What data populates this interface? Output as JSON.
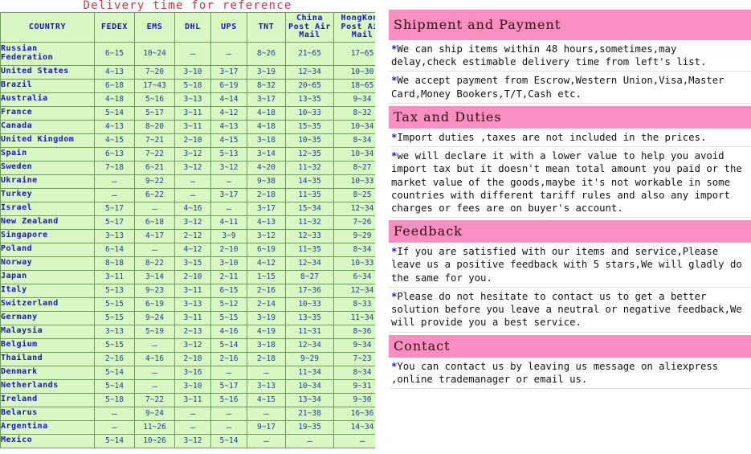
{
  "table": {
    "title": "Delivery time for reference",
    "columns": [
      "COUNTRY",
      "FEDEX",
      "EMS",
      "DHL",
      "UPS",
      "TNT",
      "China Post Air Mail",
      "HongKong Post Air Mail"
    ],
    "column_lines": [
      [
        "COUNTRY"
      ],
      [
        "FEDEX"
      ],
      [
        "EMS"
      ],
      [
        "DHL"
      ],
      [
        "UPS"
      ],
      [
        "TNT"
      ],
      [
        "China",
        "Post Air",
        "Mail"
      ],
      [
        "HongKong",
        "Post Air",
        "Mail"
      ]
    ],
    "dash": "—",
    "rows": [
      {
        "country": "Russian Federation",
        "country_lines": [
          "Russian",
          "Federation"
        ],
        "values": [
          "6~15",
          "10~24",
          "—",
          "—",
          "8~26",
          "21~65",
          "17~65"
        ]
      },
      {
        "country": "United States",
        "country_lines": [
          "United States"
        ],
        "values": [
          "4~13",
          "7~20",
          "3~10",
          "3~17",
          "3~19",
          "12~34",
          "10~30"
        ]
      },
      {
        "country": "Brazil",
        "country_lines": [
          "Brazil"
        ],
        "values": [
          "6~18",
          "17~43",
          "5~18",
          "6~19",
          "8~32",
          "20~65",
          "18~65"
        ]
      },
      {
        "country": "Australia",
        "country_lines": [
          "Australia"
        ],
        "values": [
          "4~18",
          "5~16",
          "3~13",
          "4~14",
          "3~17",
          "13~35",
          "9~34"
        ]
      },
      {
        "country": "France",
        "country_lines": [
          "France"
        ],
        "values": [
          "5~14",
          "5~17",
          "3~11",
          "4~12",
          "4~18",
          "10~33",
          "8~32"
        ]
      },
      {
        "country": "Canada",
        "country_lines": [
          "Canada"
        ],
        "values": [
          "4~13",
          "8~20",
          "3~11",
          "4~13",
          "4~18",
          "15~35",
          "10~34"
        ]
      },
      {
        "country": "United Kingdom",
        "country_lines": [
          "United Kingdom"
        ],
        "values": [
          "4~15",
          "7~21",
          "2~10",
          "4~15",
          "3~18",
          "10~35",
          "8~34"
        ]
      },
      {
        "country": "Spain",
        "country_lines": [
          "Spain"
        ],
        "values": [
          "6~13",
          "7~22",
          "3~12",
          "5~13",
          "3~14",
          "12~35",
          "10~34"
        ]
      },
      {
        "country": "Sweden",
        "country_lines": [
          "Sweden"
        ],
        "values": [
          "7~18",
          "6~21",
          "3~12",
          "3~12",
          "4~20",
          "11~32",
          "8~27"
        ]
      },
      {
        "country": "Ukraine",
        "country_lines": [
          "Ukraine"
        ],
        "values": [
          "—",
          "9~22",
          "—",
          "—",
          "9~38",
          "14~35",
          "10~33"
        ]
      },
      {
        "country": "Turkey",
        "country_lines": [
          "Turkey"
        ],
        "values": [
          "—",
          "6~22",
          "—",
          "3~17",
          "2~18",
          "11~35",
          "8~25"
        ]
      },
      {
        "country": "Israel",
        "country_lines": [
          "Israel"
        ],
        "values": [
          "5~17",
          "—",
          "4~16",
          "—",
          "3~17",
          "15~34",
          "12~34"
        ]
      },
      {
        "country": "New Zealand",
        "country_lines": [
          "New Zealand"
        ],
        "values": [
          "5~17",
          "6~18",
          "3~12",
          "4~11",
          "4~13",
          "11~32",
          "7~26"
        ]
      },
      {
        "country": "Singapore",
        "country_lines": [
          "Singapore"
        ],
        "values": [
          "3~13",
          "4~17",
          "2~12",
          "3~9",
          "3~12",
          "12~33",
          "9~29"
        ]
      },
      {
        "country": "Poland",
        "country_lines": [
          "Poland"
        ],
        "values": [
          "6~14",
          "—",
          "4~12",
          "2~10",
          "6~19",
          "11~35",
          "8~34"
        ]
      },
      {
        "country": "Norway",
        "country_lines": [
          "Norway"
        ],
        "values": [
          "8~18",
          "8~22",
          "3~15",
          "3~10",
          "4~12",
          "12~34",
          "10~33"
        ]
      },
      {
        "country": "Japan",
        "country_lines": [
          "Japan"
        ],
        "values": [
          "3~11",
          "3~14",
          "2~10",
          "2~11",
          "1~15",
          "8~27",
          "6~34"
        ]
      },
      {
        "country": "Italy",
        "country_lines": [
          "Italy"
        ],
        "values": [
          "5~13",
          "9~23",
          "3~11",
          "6~15",
          "2~16",
          "17~36",
          "12~34"
        ]
      },
      {
        "country": "Switzerland",
        "country_lines": [
          "Switzerland"
        ],
        "values": [
          "5~15",
          "6~19",
          "3~13",
          "5~12",
          "2~14",
          "10~33",
          "8~33"
        ]
      },
      {
        "country": "Germany",
        "country_lines": [
          "Germany"
        ],
        "values": [
          "5~15",
          "9~24",
          "3~11",
          "5~15",
          "3~19",
          "13~35",
          "11~34"
        ]
      },
      {
        "country": "Malaysia",
        "country_lines": [
          "Malaysia"
        ],
        "values": [
          "3~13",
          "5~19",
          "2~13",
          "4~16",
          "4~19",
          "11~31",
          "8~36"
        ]
      },
      {
        "country": "Belgium",
        "country_lines": [
          "Belgium"
        ],
        "values": [
          "5~15",
          "—",
          "3~12",
          "5~14",
          "3~18",
          "12~34",
          "9~34"
        ]
      },
      {
        "country": "Thailand",
        "country_lines": [
          "Thailand"
        ],
        "values": [
          "2~16",
          "4~16",
          "2~10",
          "2~16",
          "2~18",
          "9~29",
          "7~23"
        ]
      },
      {
        "country": "Denmark",
        "country_lines": [
          "Denmark"
        ],
        "values": [
          "5~14",
          "—",
          "3~16",
          "—",
          "—",
          "11~34",
          "8~34"
        ]
      },
      {
        "country": "Netherlands",
        "country_lines": [
          "Netherlands"
        ],
        "values": [
          "5~14",
          "—",
          "3~10",
          "5~17",
          "3~13",
          "10~34",
          "9~31"
        ]
      },
      {
        "country": "Ireland",
        "country_lines": [
          "Ireland"
        ],
        "values": [
          "5~18",
          "7~22",
          "3~11",
          "5~16",
          "4~15",
          "13~34",
          "9~30"
        ]
      },
      {
        "country": "Belarus",
        "country_lines": [
          "Belarus"
        ],
        "values": [
          "—",
          "9~24",
          "—",
          "—",
          "—",
          "21~38",
          "16~36"
        ]
      },
      {
        "country": "Argentina",
        "country_lines": [
          "Argentina"
        ],
        "values": [
          "—",
          "11~26",
          "—",
          "—",
          "9~17",
          "19~35",
          "14~34"
        ]
      },
      {
        "country": "Mexico",
        "country_lines": [
          "Mexico"
        ],
        "values": [
          "5~14",
          "10~26",
          "3~12",
          "5~14",
          "—",
          "—",
          "—"
        ]
      }
    ]
  },
  "info": {
    "sections": [
      {
        "heading": "Shipment and Payment",
        "paragraphs": [
          "*We can ship items within 48 hours,sometimes,may delay,check estimable delivery time from left's list.",
          "*We accept payment from Escrow,Western Union,Visa,Master Card,Money Bookers,T/T,Cash etc."
        ]
      },
      {
        "heading": "Tax and Duties",
        "paragraphs": [
          "*Import duties ,taxes are not included in the prices.",
          "*we will declare it with a lower value to help you avoid import tax but it doesn't mean total amount you paid or the market value of the goods,maybe it's not workable in some countries with different tariff rules and also any import charges or fees are on buyer's account."
        ]
      },
      {
        "heading": "Feedback",
        "paragraphs": [
          "*If you are satisfied with our items and service,Please leave us a positive feedback with 5 stars,We will gladly do the same for you.",
          "*Please do not hesitate to contact us to get a better solution before you leave a neutral or negative feedback,We will provide you a best service."
        ]
      },
      {
        "heading": "Contact",
        "paragraphs": [
          "*You can contact us by leaving us message on aliexpress ,online trademanager or email us."
        ]
      }
    ]
  },
  "colors": {
    "title_red": "#c33a4e",
    "table_green": "#d9f7c2",
    "table_border": "#6f9c5a",
    "header_blue": "#1515c8",
    "value_blue": "#20408f",
    "panel_pink": "#f98fc0"
  }
}
